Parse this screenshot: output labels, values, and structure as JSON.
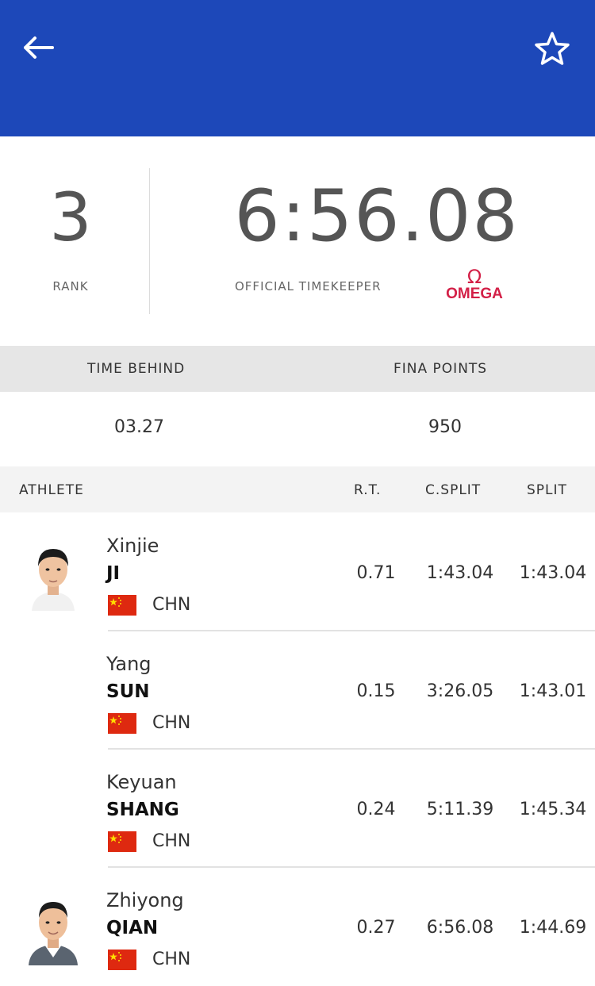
{
  "header": {
    "bg_color": "#1d48b9",
    "back_icon": "arrow-left-icon",
    "favorite_icon": "star-outline-icon"
  },
  "summary": {
    "rank": "3",
    "rank_label": "RANK",
    "time": "6:56.08",
    "timekeeper_label": "OFFICIAL TIMEKEEPER",
    "brand": "OMEGA",
    "brand_symbol": "Ω",
    "brand_color": "#d32047"
  },
  "stats": {
    "time_behind_label": "TIME BEHIND",
    "time_behind_value": "03.27",
    "fina_points_label": "FINA POINTS",
    "fina_points_value": "950"
  },
  "table": {
    "headers": {
      "athlete": "ATHLETE",
      "rt": "R.T.",
      "csplit": "C.SPLIT",
      "split": "SPLIT"
    },
    "rows": [
      {
        "first": "Xinjie",
        "last": "JI",
        "country": "CHN",
        "rt": "0.71",
        "csplit": "1:43.04",
        "split": "1:43.04",
        "photo": true
      },
      {
        "first": "Yang",
        "last": "SUN",
        "country": "CHN",
        "rt": "0.15",
        "csplit": "3:26.05",
        "split": "1:43.01",
        "photo": false
      },
      {
        "first": "Keyuan",
        "last": "SHANG",
        "country": "CHN",
        "rt": "0.24",
        "csplit": "5:11.39",
        "split": "1:45.34",
        "photo": false
      },
      {
        "first": "Zhiyong",
        "last": "QIAN",
        "country": "CHN",
        "rt": "0.27",
        "csplit": "6:56.08",
        "split": "1:44.69",
        "photo": true
      }
    ]
  }
}
